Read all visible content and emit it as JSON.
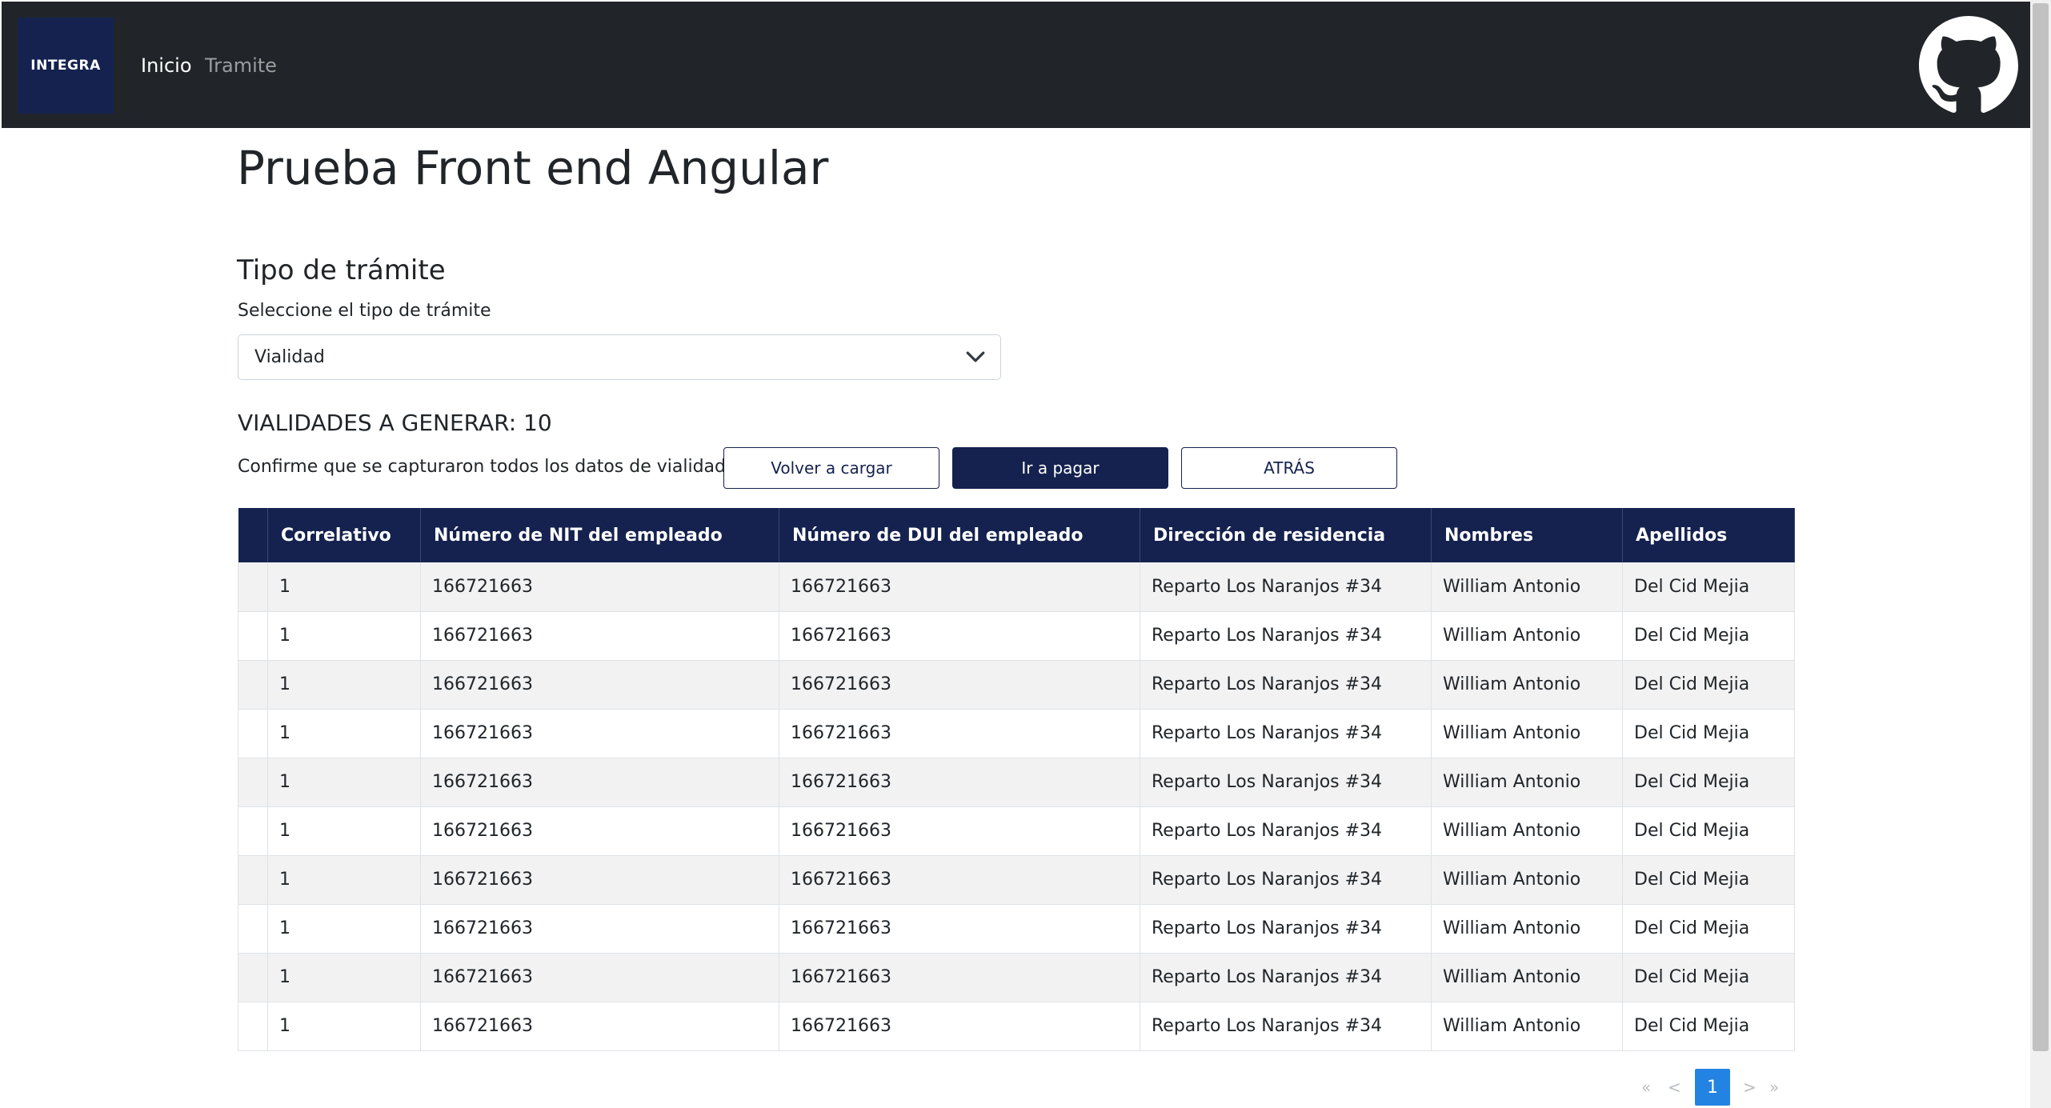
{
  "navbar": {
    "brand": "INTEGRA",
    "links": [
      {
        "label": "Inicio",
        "active": true
      },
      {
        "label": "Tramite",
        "active": false
      }
    ],
    "github_icon": "github-icon"
  },
  "main": {
    "title": "Prueba Front end Angular",
    "section_title": "Tipo de trámite",
    "select_label": "Seleccione el tipo de trámite",
    "select_value": "Vialidad",
    "count_title": "VIALIDADES A GENERAR: 10",
    "confirm_text": "Confirme que se capturaron todos los datos de vialidad:",
    "buttons": {
      "reload": "Volver a cargar",
      "pay": "Ir a pagar",
      "back": "ATRÁS"
    }
  },
  "table": {
    "headers": [
      "",
      "Correlativo",
      "Número de NIT del empleado",
      "Número de DUI del empleado",
      "Dirección de residencia",
      "Nombres",
      "Apellidos"
    ],
    "rows": [
      [
        "",
        "1",
        "166721663",
        "166721663",
        "Reparto Los Naranjos #34",
        "William Antonio",
        "Del Cid Mejia"
      ],
      [
        "",
        "1",
        "166721663",
        "166721663",
        "Reparto Los Naranjos #34",
        "William Antonio",
        "Del Cid Mejia"
      ],
      [
        "",
        "1",
        "166721663",
        "166721663",
        "Reparto Los Naranjos #34",
        "William Antonio",
        "Del Cid Mejia"
      ],
      [
        "",
        "1",
        "166721663",
        "166721663",
        "Reparto Los Naranjos #34",
        "William Antonio",
        "Del Cid Mejia"
      ],
      [
        "",
        "1",
        "166721663",
        "166721663",
        "Reparto Los Naranjos #34",
        "William Antonio",
        "Del Cid Mejia"
      ],
      [
        "",
        "1",
        "166721663",
        "166721663",
        "Reparto Los Naranjos #34",
        "William Antonio",
        "Del Cid Mejia"
      ],
      [
        "",
        "1",
        "166721663",
        "166721663",
        "Reparto Los Naranjos #34",
        "William Antonio",
        "Del Cid Mejia"
      ],
      [
        "",
        "1",
        "166721663",
        "166721663",
        "Reparto Los Naranjos #34",
        "William Antonio",
        "Del Cid Mejia"
      ],
      [
        "",
        "1",
        "166721663",
        "166721663",
        "Reparto Los Naranjos #34",
        "William Antonio",
        "Del Cid Mejia"
      ],
      [
        "",
        "1",
        "166721663",
        "166721663",
        "Reparto Los Naranjos #34",
        "William Antonio",
        "Del Cid Mejia"
      ]
    ]
  },
  "pagination": {
    "first": "«",
    "prev": "<",
    "current": "1",
    "next": ">",
    "last": "»"
  },
  "colors": {
    "navbar": "#212529",
    "brand": "#15224f",
    "primary": "#15224f",
    "page_active": "#2383e2"
  }
}
